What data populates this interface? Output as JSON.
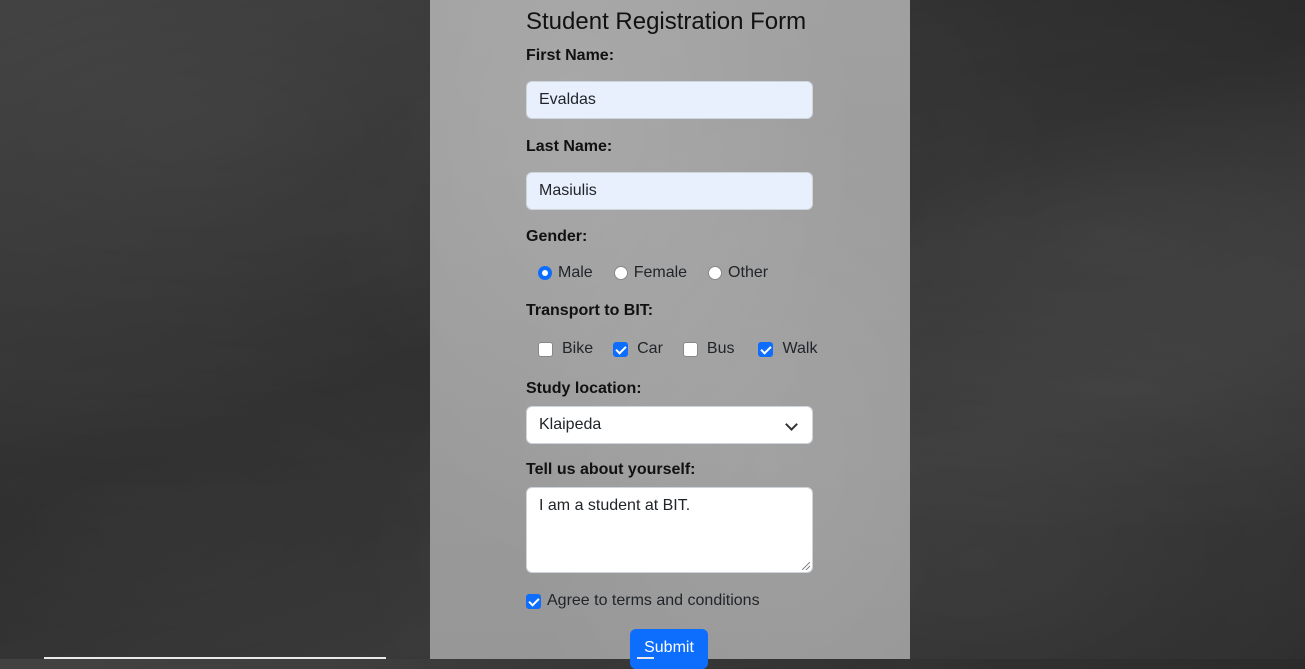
{
  "form": {
    "title": "Student Registration Form",
    "first_name": {
      "label": "First Name:",
      "value": "Evaldas"
    },
    "last_name": {
      "label": "Last Name:",
      "value": "Masiulis"
    },
    "gender": {
      "label": "Gender:",
      "options": [
        {
          "label": "Male",
          "selected": true
        },
        {
          "label": "Female",
          "selected": false
        },
        {
          "label": "Other",
          "selected": false
        }
      ]
    },
    "transport": {
      "label": "Transport to BIT:",
      "options": [
        {
          "label": "Bike",
          "checked": false
        },
        {
          "label": "Car",
          "checked": true
        },
        {
          "label": "Bus",
          "checked": false
        },
        {
          "label": "Walk",
          "checked": true
        }
      ]
    },
    "study_location": {
      "label": "Study location:",
      "value": "Klaipeda"
    },
    "about": {
      "label": "Tell us about yourself:",
      "value": "I am a student at BIT."
    },
    "terms": {
      "label": "Agree to terms and conditions",
      "checked": true
    },
    "submit_label": "Submit"
  },
  "colors": {
    "accent": "#0d6efd",
    "autofill_bg": "#e8f0fe",
    "panel_bg": "#9c9c9c",
    "chalkboard_bg": "#2d2d2d"
  }
}
